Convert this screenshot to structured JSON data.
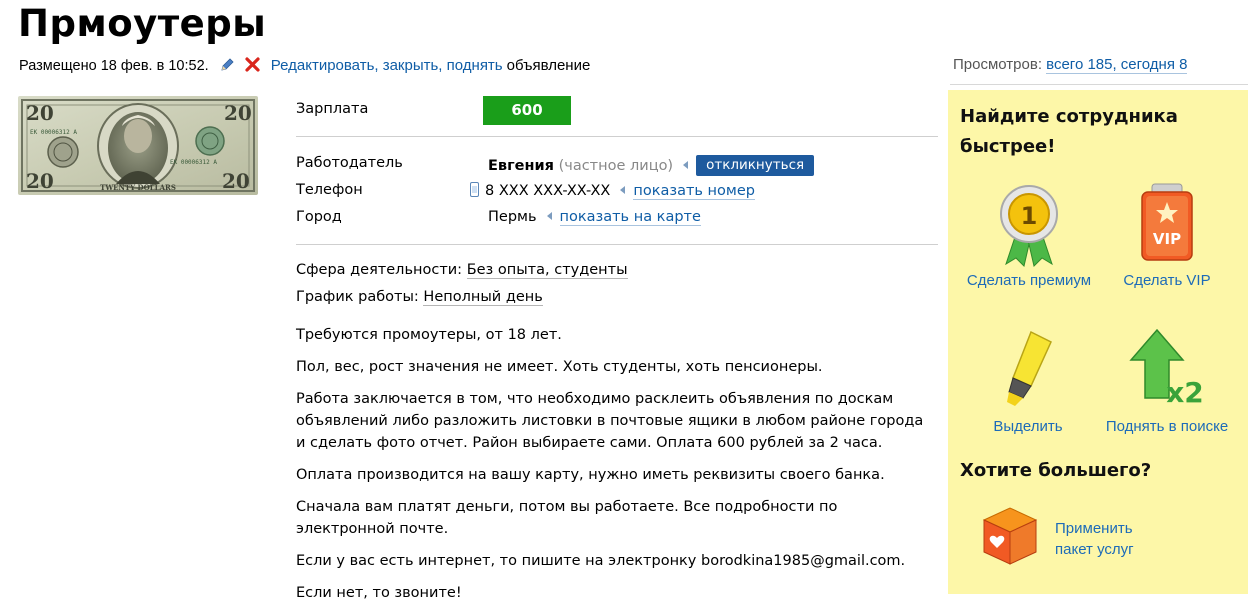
{
  "title": "Прмоутеры",
  "meta": {
    "posted": "Размещено 18 фев. в 10:52.",
    "actions": "Редактировать, закрыть, поднять",
    "tail": "объявление"
  },
  "views": {
    "label": "Просмотров:",
    "total": "всего 185, сегодня 8"
  },
  "details": {
    "salary_label": "Зарплата",
    "salary_value": "600 руб.",
    "employer_label": "Работодатель",
    "employer_name": "Евгения",
    "employer_type": "(частное лицо)",
    "respond_button": "откликнуться",
    "phone_label": "Телефон",
    "phone_value": "8 XXX XXX-XX-XX",
    "phone_show": "показать номер",
    "city_label": "Город",
    "city_value": "Пермь",
    "city_map": "показать на карте",
    "sphere_label": "Сфера деятельности:",
    "sphere_value": "Без опыта, студенты",
    "schedule_label": "График работы:",
    "schedule_value": "Неполный день"
  },
  "description": [
    "Требуются промоутеры, от 18 лет.",
    "Пол, вес, рост значения не имеет. Хоть студенты, хоть пенсионеры.",
    "Работа заключается в том, что необходимо расклеить объявления по доскам объявлений либо разложить листовки в почтовые ящики в любом районе города и сделать фото отчет. Район выбираете сами. Оплата 600 рублей за 2 часа.",
    "Оплата производится на вашу карту, нужно иметь реквизиты своего банка.",
    "Сначала вам платят деньги, потом вы работаете. Все подробности по электронной почте.",
    "Если у вас есть интернет, то пишите на электронку borodkina1985@gmail.com.",
    "Если нет, то звоните!"
  ],
  "promo": {
    "heading": "Найдите сотрудника быстрее!",
    "premium": "Сделать премиум",
    "vip": "Сделать VIP",
    "vip_badge": "VIP",
    "medal_number": "1",
    "highlight": "Выделить",
    "raise": "Поднять в поиске",
    "raise_badge": "x2",
    "more_heading": "Хотите большего?",
    "package_line1": "Применить",
    "package_line2": "пакет услуг"
  },
  "banknote": {
    "denomination": "20",
    "serial": "EK 00006312 A",
    "caption": "TWENTY DOLLARS"
  },
  "colors": {
    "link": "#0f5da6",
    "salary_badge": "#1a9e1a",
    "respond_button": "#1e5a9e",
    "promo_bg": "#fdf7a8"
  }
}
